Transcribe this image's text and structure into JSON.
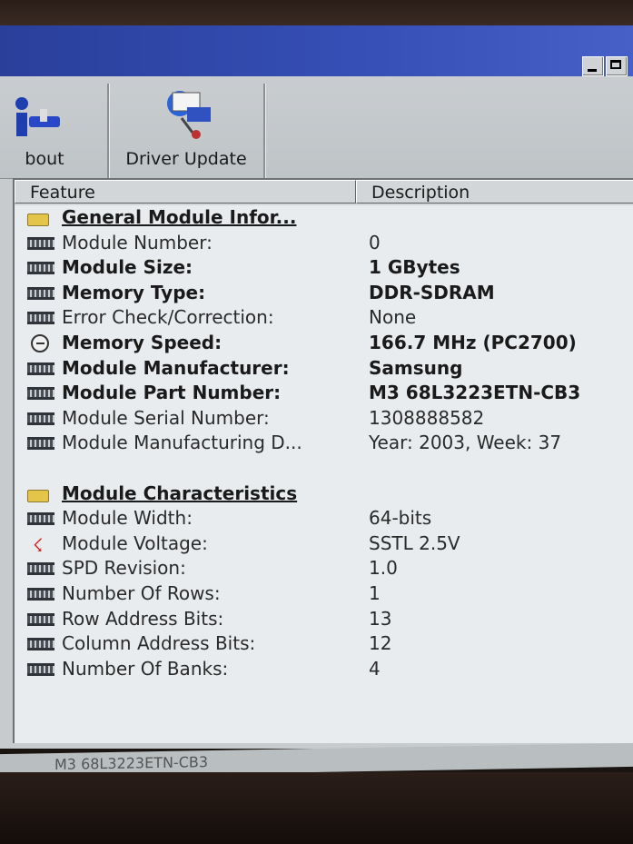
{
  "toolbar": {
    "about_label": "bout",
    "driver_update_label": "Driver Update"
  },
  "columns": {
    "feature": "Feature",
    "description": "Description"
  },
  "rows": [
    {
      "icon": "folder-icon",
      "feature": "General Module Infor...",
      "value": "",
      "style": "group"
    },
    {
      "icon": "memory-chip-icon",
      "feature": "Module Number:",
      "value": "0",
      "style": "normal"
    },
    {
      "icon": "memory-chip-icon",
      "feature": "Module Size:",
      "value": "1 GBytes",
      "style": "bold"
    },
    {
      "icon": "memory-chip-icon",
      "feature": "Memory Type:",
      "value": "DDR-SDRAM",
      "style": "bold"
    },
    {
      "icon": "memory-chip-icon",
      "feature": "Error Check/Correction:",
      "value": "None",
      "style": "normal"
    },
    {
      "icon": "clock-icon",
      "feature": "Memory Speed:",
      "value": "166.7 MHz (PC2700)",
      "style": "bold"
    },
    {
      "icon": "memory-chip-icon",
      "feature": "Module Manufacturer:",
      "value": "Samsung",
      "style": "bold"
    },
    {
      "icon": "memory-chip-icon",
      "feature": "Module Part Number:",
      "value": "M3 68L3223ETN-CB3",
      "style": "bold"
    },
    {
      "icon": "memory-chip-icon",
      "feature": "Module Serial Number:",
      "value": "1308888582",
      "style": "normal"
    },
    {
      "icon": "memory-chip-icon",
      "feature": "Module Manufacturing D...",
      "value": "Year: 2003, Week: 37",
      "style": "normal"
    },
    {
      "icon": "",
      "feature": "",
      "value": "",
      "style": "blank"
    },
    {
      "icon": "folder-icon",
      "feature": "Module Characteristics",
      "value": "",
      "style": "group"
    },
    {
      "icon": "memory-chip-icon",
      "feature": "Module Width:",
      "value": "64-bits",
      "style": "normal"
    },
    {
      "icon": "voltage-icon",
      "feature": "Module Voltage:",
      "value": "SSTL 2.5V",
      "style": "normal"
    },
    {
      "icon": "memory-chip-icon",
      "feature": "SPD Revision:",
      "value": "1.0",
      "style": "normal"
    },
    {
      "icon": "memory-chip-icon",
      "feature": "Number Of Rows:",
      "value": "1",
      "style": "normal"
    },
    {
      "icon": "memory-chip-icon",
      "feature": "Row Address Bits:",
      "value": "13",
      "style": "normal"
    },
    {
      "icon": "memory-chip-icon",
      "feature": "Column Address Bits:",
      "value": "12",
      "style": "normal"
    },
    {
      "icon": "memory-chip-icon",
      "feature": "Number Of Banks:",
      "value": "4",
      "style": "normal"
    }
  ],
  "status_text": "M3 68L3223ETN-CB3"
}
